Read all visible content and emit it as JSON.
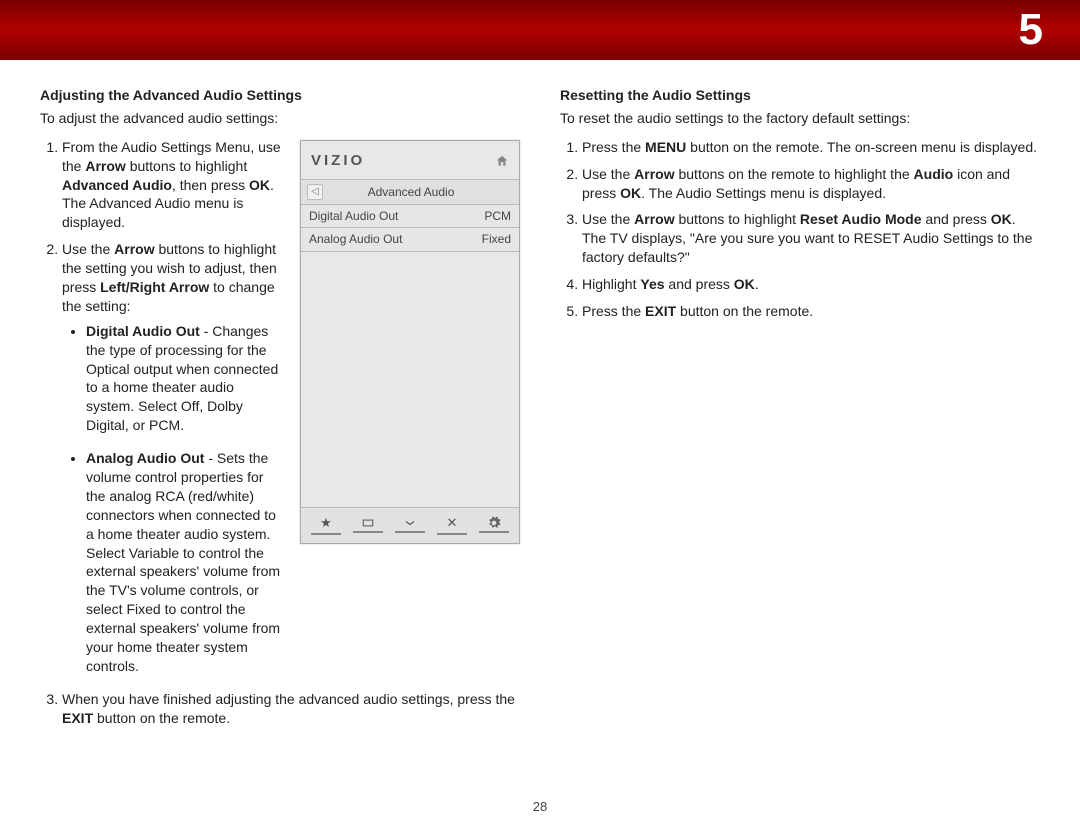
{
  "header": {
    "chapter": "5"
  },
  "page_number": "28",
  "left": {
    "title": "Adjusting the Advanced Audio Settings",
    "lead": "To adjust the advanced audio settings:",
    "step1_a": "From the Audio Settings Menu, use the ",
    "step1_b": "Arrow",
    "step1_c": " buttons to highlight ",
    "step1_d": "Advanced Audio",
    "step1_e": ", then press ",
    "step1_f": "OK",
    "step1_g": ". The Advanced Audio menu is displayed.",
    "step2_a": "Use the ",
    "step2_b": "Arrow",
    "step2_c": " buttons to highlight the setting you wish to adjust, then press ",
    "step2_d": "Left/Right Arrow",
    "step2_e": " to change the setting:",
    "bullet1_a": "Digital Audio Out",
    "bullet1_b": " - Changes the type of processing for the Optical output when connected to a home theater audio system. Select Off, Dolby Digital, or PCM.",
    "bullet2_a": "Analog Audio Out",
    "bullet2_b": " - Sets the volume control properties for the analog RCA (red/white) connectors when connected to a home theater audio system. Select Variable to control the external speakers' volume from the TV's volume controls, or select Fixed to control the external speakers' volume from your home theater system controls.",
    "step3_a": "When you have finished adjusting the advanced audio settings, press the ",
    "step3_b": "EXIT",
    "step3_c": " button on the remote."
  },
  "osd": {
    "logo": "VIZIO",
    "title": "Advanced Audio",
    "rows": [
      {
        "label": "Digital Audio Out",
        "value": "PCM"
      },
      {
        "label": "Analog Audio Out",
        "value": "Fixed"
      }
    ]
  },
  "right": {
    "title": "Resetting the Audio Settings",
    "lead": "To reset the audio settings to the factory default settings:",
    "step1_a": "Press the ",
    "step1_b": "MENU",
    "step1_c": " button on the remote. The on-screen menu is displayed.",
    "step2_a": "Use the ",
    "step2_b": "Arrow",
    "step2_c": " buttons on the remote to highlight the ",
    "step2_d": "Audio",
    "step2_e": " icon and press ",
    "step2_f": "OK",
    "step2_g": ". The Audio Settings menu is displayed.",
    "step3_a": "Use the ",
    "step3_b": "Arrow",
    "step3_c": " buttons to highlight ",
    "step3_d": "Reset Audio Mode",
    "step3_e": " and press ",
    "step3_f": "OK",
    "step3_g": ". The TV displays, \"Are you sure you want to RESET Audio Settings to the factory defaults?\"",
    "step4_a": "Highlight ",
    "step4_b": "Yes",
    "step4_c": " and press ",
    "step4_d": "OK",
    "step4_e": ".",
    "step5_a": "Press the ",
    "step5_b": "EXIT",
    "step5_c": " button on the remote."
  }
}
